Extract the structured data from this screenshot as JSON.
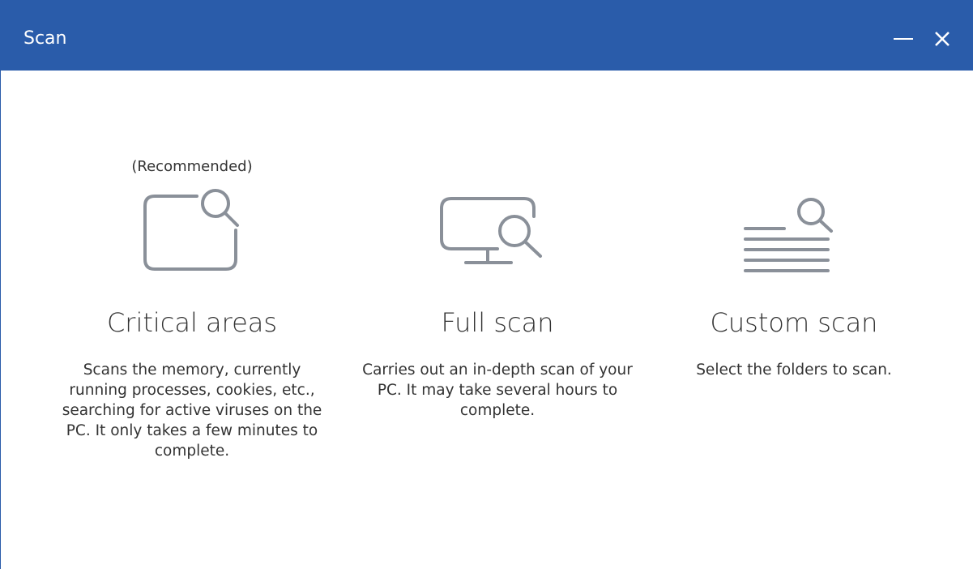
{
  "window": {
    "title": "Scan",
    "minimize_glyph": "—",
    "close_glyph": "X"
  },
  "colors": {
    "titlebar": "#2a5caa",
    "icon_stroke": "#8a9099",
    "text": "#333333"
  },
  "options": [
    {
      "badge": "(Recommended)",
      "icon": "folder-search-icon",
      "title": "Critical areas",
      "description": "Scans the memory, currently running processes, cookies, etc., searching for active viruses on the PC. It only takes a few minutes to complete."
    },
    {
      "badge": "",
      "icon": "monitor-search-icon",
      "title": "Full scan",
      "description": "Carries out an in-depth scan of your PC. It may take several hours to complete."
    },
    {
      "badge": "",
      "icon": "list-search-icon",
      "title": "Custom scan",
      "description": "Select the folders to scan."
    }
  ]
}
